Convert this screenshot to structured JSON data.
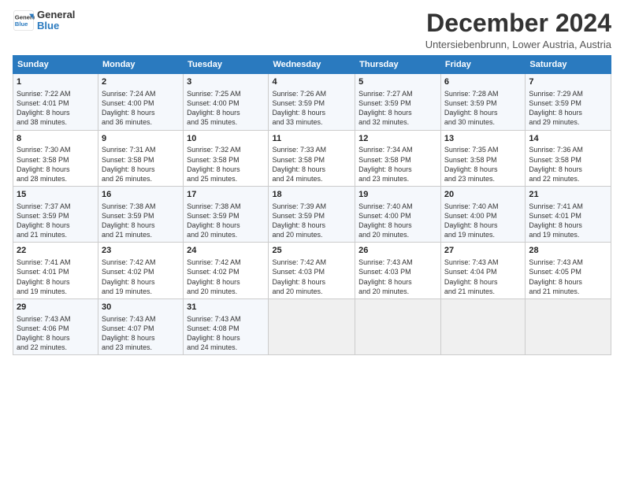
{
  "logo": {
    "line1": "General",
    "line2": "Blue"
  },
  "title": "December 2024",
  "subtitle": "Untersiebenbrunn, Lower Austria, Austria",
  "days_of_week": [
    "Sunday",
    "Monday",
    "Tuesday",
    "Wednesday",
    "Thursday",
    "Friday",
    "Saturday"
  ],
  "weeks": [
    [
      {
        "day": "1",
        "detail": "Sunrise: 7:22 AM\nSunset: 4:01 PM\nDaylight: 8 hours\nand 38 minutes."
      },
      {
        "day": "2",
        "detail": "Sunrise: 7:24 AM\nSunset: 4:00 PM\nDaylight: 8 hours\nand 36 minutes."
      },
      {
        "day": "3",
        "detail": "Sunrise: 7:25 AM\nSunset: 4:00 PM\nDaylight: 8 hours\nand 35 minutes."
      },
      {
        "day": "4",
        "detail": "Sunrise: 7:26 AM\nSunset: 3:59 PM\nDaylight: 8 hours\nand 33 minutes."
      },
      {
        "day": "5",
        "detail": "Sunrise: 7:27 AM\nSunset: 3:59 PM\nDaylight: 8 hours\nand 32 minutes."
      },
      {
        "day": "6",
        "detail": "Sunrise: 7:28 AM\nSunset: 3:59 PM\nDaylight: 8 hours\nand 30 minutes."
      },
      {
        "day": "7",
        "detail": "Sunrise: 7:29 AM\nSunset: 3:59 PM\nDaylight: 8 hours\nand 29 minutes."
      }
    ],
    [
      {
        "day": "8",
        "detail": "Sunrise: 7:30 AM\nSunset: 3:58 PM\nDaylight: 8 hours\nand 28 minutes."
      },
      {
        "day": "9",
        "detail": "Sunrise: 7:31 AM\nSunset: 3:58 PM\nDaylight: 8 hours\nand 26 minutes."
      },
      {
        "day": "10",
        "detail": "Sunrise: 7:32 AM\nSunset: 3:58 PM\nDaylight: 8 hours\nand 25 minutes."
      },
      {
        "day": "11",
        "detail": "Sunrise: 7:33 AM\nSunset: 3:58 PM\nDaylight: 8 hours\nand 24 minutes."
      },
      {
        "day": "12",
        "detail": "Sunrise: 7:34 AM\nSunset: 3:58 PM\nDaylight: 8 hours\nand 23 minutes."
      },
      {
        "day": "13",
        "detail": "Sunrise: 7:35 AM\nSunset: 3:58 PM\nDaylight: 8 hours\nand 23 minutes."
      },
      {
        "day": "14",
        "detail": "Sunrise: 7:36 AM\nSunset: 3:58 PM\nDaylight: 8 hours\nand 22 minutes."
      }
    ],
    [
      {
        "day": "15",
        "detail": "Sunrise: 7:37 AM\nSunset: 3:59 PM\nDaylight: 8 hours\nand 21 minutes."
      },
      {
        "day": "16",
        "detail": "Sunrise: 7:38 AM\nSunset: 3:59 PM\nDaylight: 8 hours\nand 21 minutes."
      },
      {
        "day": "17",
        "detail": "Sunrise: 7:38 AM\nSunset: 3:59 PM\nDaylight: 8 hours\nand 20 minutes."
      },
      {
        "day": "18",
        "detail": "Sunrise: 7:39 AM\nSunset: 3:59 PM\nDaylight: 8 hours\nand 20 minutes."
      },
      {
        "day": "19",
        "detail": "Sunrise: 7:40 AM\nSunset: 4:00 PM\nDaylight: 8 hours\nand 20 minutes."
      },
      {
        "day": "20",
        "detail": "Sunrise: 7:40 AM\nSunset: 4:00 PM\nDaylight: 8 hours\nand 19 minutes."
      },
      {
        "day": "21",
        "detail": "Sunrise: 7:41 AM\nSunset: 4:01 PM\nDaylight: 8 hours\nand 19 minutes."
      }
    ],
    [
      {
        "day": "22",
        "detail": "Sunrise: 7:41 AM\nSunset: 4:01 PM\nDaylight: 8 hours\nand 19 minutes."
      },
      {
        "day": "23",
        "detail": "Sunrise: 7:42 AM\nSunset: 4:02 PM\nDaylight: 8 hours\nand 19 minutes."
      },
      {
        "day": "24",
        "detail": "Sunrise: 7:42 AM\nSunset: 4:02 PM\nDaylight: 8 hours\nand 20 minutes."
      },
      {
        "day": "25",
        "detail": "Sunrise: 7:42 AM\nSunset: 4:03 PM\nDaylight: 8 hours\nand 20 minutes."
      },
      {
        "day": "26",
        "detail": "Sunrise: 7:43 AM\nSunset: 4:03 PM\nDaylight: 8 hours\nand 20 minutes."
      },
      {
        "day": "27",
        "detail": "Sunrise: 7:43 AM\nSunset: 4:04 PM\nDaylight: 8 hours\nand 21 minutes."
      },
      {
        "day": "28",
        "detail": "Sunrise: 7:43 AM\nSunset: 4:05 PM\nDaylight: 8 hours\nand 21 minutes."
      }
    ],
    [
      {
        "day": "29",
        "detail": "Sunrise: 7:43 AM\nSunset: 4:06 PM\nDaylight: 8 hours\nand 22 minutes."
      },
      {
        "day": "30",
        "detail": "Sunrise: 7:43 AM\nSunset: 4:07 PM\nDaylight: 8 hours\nand 23 minutes."
      },
      {
        "day": "31",
        "detail": "Sunrise: 7:43 AM\nSunset: 4:08 PM\nDaylight: 8 hours\nand 24 minutes."
      },
      {
        "day": "",
        "detail": ""
      },
      {
        "day": "",
        "detail": ""
      },
      {
        "day": "",
        "detail": ""
      },
      {
        "day": "",
        "detail": ""
      }
    ]
  ]
}
